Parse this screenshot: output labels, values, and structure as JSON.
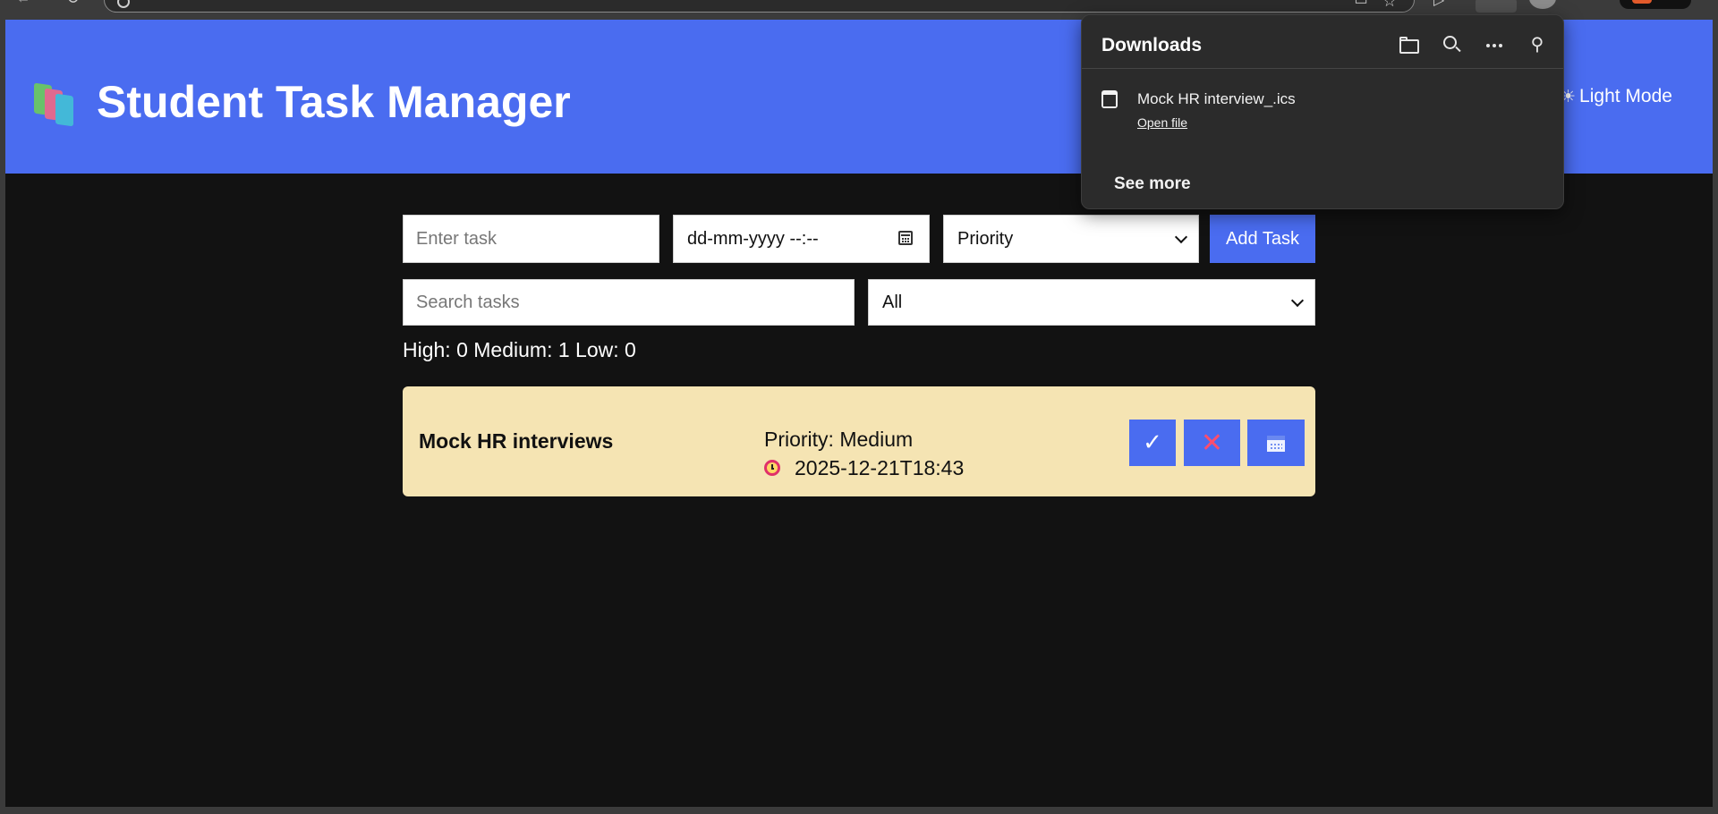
{
  "app": {
    "title": "Student Task Manager",
    "mode_toggle": "Light Mode",
    "mode_icon": "sun-icon",
    "accent": "#4a6cf0",
    "background": "#121212"
  },
  "form": {
    "task_placeholder": "Enter task",
    "date_placeholder": "dd-mm-yyyy --:--",
    "priority_placeholder": "Priority",
    "add_label": "Add Task",
    "search_placeholder": "Search tasks",
    "filter_value": "All"
  },
  "counts": {
    "text": "High: 0 Medium: 1 Low: 0"
  },
  "tasks": [
    {
      "name": "Mock HR interviews",
      "priority": "Priority: Medium",
      "due": "2025-12-21T18:43",
      "card_color": "#f5e4b3",
      "actions": {
        "done": "✓",
        "delete": "✕"
      }
    }
  ],
  "downloads": {
    "title": "Downloads",
    "file_name": "Mock HR interview_.ics",
    "open_file": "Open file",
    "see_more": "See more"
  }
}
